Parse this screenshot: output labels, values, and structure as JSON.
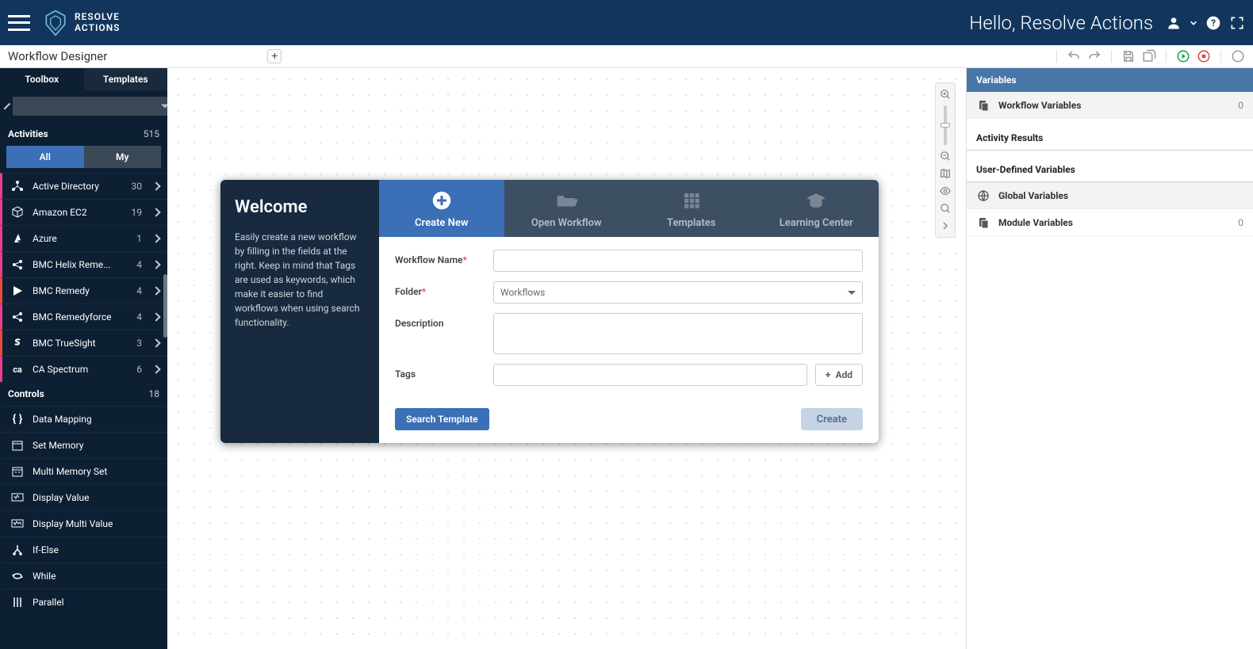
{
  "header": {
    "logo_top": "RESOLVE",
    "logo_bottom": "ACTIONS",
    "greeting": "Hello, Resolve Actions"
  },
  "subheader": {
    "title": "Workflow Designer"
  },
  "sidebar": {
    "tabs": {
      "toolbox": "Toolbox",
      "templates": "Templates"
    },
    "activities_label": "Activities",
    "activities_count": "515",
    "toggle": {
      "all": "All",
      "my": "My"
    },
    "activities": [
      {
        "label": "Active Directory",
        "count": "30"
      },
      {
        "label": "Amazon EC2",
        "count": "19"
      },
      {
        "label": "Azure",
        "count": "1"
      },
      {
        "label": "BMC Helix Reme...",
        "count": "4"
      },
      {
        "label": "BMC Remedy",
        "count": "4"
      },
      {
        "label": "BMC Remedyforce",
        "count": "4"
      },
      {
        "label": "BMC TrueSight",
        "count": "3"
      },
      {
        "label": "CA Spectrum",
        "count": "6"
      }
    ],
    "controls_label": "Controls",
    "controls_count": "18",
    "controls": [
      {
        "label": "Data Mapping"
      },
      {
        "label": "Set Memory"
      },
      {
        "label": "Multi Memory Set"
      },
      {
        "label": "Display Value"
      },
      {
        "label": "Display Multi Value"
      },
      {
        "label": "If-Else"
      },
      {
        "label": "While"
      },
      {
        "label": "Parallel"
      }
    ]
  },
  "welcome": {
    "title": "Welcome",
    "body": "Easily create a new workflow by filling in the fields at the right. Keep in mind that Tags are used as keywords, which make it easier to find workflows when using search functionality.",
    "tabs": {
      "create": "Create New",
      "open": "Open Workflow",
      "templates": "Templates",
      "learning": "Learning Center"
    },
    "form": {
      "name_label": "Workflow Name",
      "folder_label": "Folder",
      "folder_value": "Workflows",
      "description_label": "Description",
      "tags_label": "Tags",
      "add_btn": "Add",
      "search_template_btn": "Search Template",
      "create_btn": "Create"
    }
  },
  "vars": {
    "header": "Variables",
    "workflow_vars": "Workflow Variables",
    "workflow_count": "0",
    "activity_results": "Activity Results",
    "user_defined": "User-Defined Variables",
    "global_vars": "Global Variables",
    "module_vars": "Module Variables",
    "module_count": "0"
  }
}
